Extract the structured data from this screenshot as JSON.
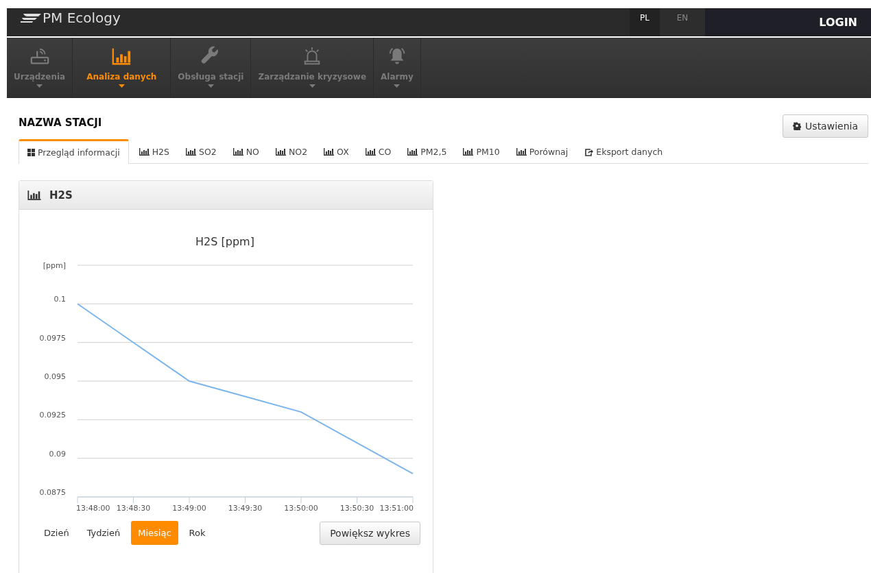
{
  "header": {
    "logo": "PM Ecology",
    "languages": [
      {
        "label": "PL",
        "selected": true
      },
      {
        "label": "EN",
        "selected": false
      }
    ],
    "login": "LOGIN"
  },
  "nav": [
    {
      "label": "Urządzenia",
      "kind": "router",
      "selected": false
    },
    {
      "label": "Analiza danych",
      "kind": "chart",
      "selected": true
    },
    {
      "label": "Obsługa stacji",
      "kind": "wrench",
      "selected": false
    },
    {
      "label": "Zarządzanie kryzysowe",
      "kind": "beacon",
      "selected": false
    },
    {
      "label": "Alarmy",
      "kind": "bell",
      "selected": false
    }
  ],
  "station": {
    "title": "NAZWA STACJI",
    "settings_button": "Ustawienia"
  },
  "tabs": [
    {
      "label": "Przegląd informacji",
      "kind": "grid",
      "selected": true
    },
    {
      "label": "H2S",
      "kind": "chart",
      "selected": false
    },
    {
      "label": "SO2",
      "kind": "chart",
      "selected": false
    },
    {
      "label": "NO",
      "kind": "chart",
      "selected": false
    },
    {
      "label": "NO2",
      "kind": "chart",
      "selected": false
    },
    {
      "label": "OX",
      "kind": "chart",
      "selected": false
    },
    {
      "label": "CO",
      "kind": "chart",
      "selected": false
    },
    {
      "label": "PM2,5",
      "kind": "chart",
      "selected": false
    },
    {
      "label": "PM10",
      "kind": "chart",
      "selected": false
    },
    {
      "label": "Porównaj",
      "kind": "chart",
      "selected": false
    },
    {
      "label": "Eksport danych",
      "kind": "export",
      "selected": false
    }
  ],
  "panel": {
    "title": "H2S",
    "chart_data": {
      "type": "line",
      "title": "H2S [ppm]",
      "ylabel": "[ppm]",
      "x": [
        "13:48:00",
        "13:48:30",
        "13:49:00",
        "13:49:30",
        "13:50:00",
        "13:50:30",
        "13:51:00"
      ],
      "series": [
        {
          "color": "#7cb5ec",
          "values": [
            0.1,
            0.0975,
            0.095,
            0.094,
            0.093,
            0.091,
            0.089
          ]
        }
      ],
      "ylim": [
        0.0875,
        0.1025
      ],
      "yticks": [
        0.0875,
        0.09,
        0.0925,
        0.095,
        0.0975,
        0.1
      ],
      "grid": true
    },
    "periods": [
      {
        "label": "Dzień",
        "selected": false
      },
      {
        "label": "Tydzień",
        "selected": false
      },
      {
        "label": "Miesiąc",
        "selected": true
      },
      {
        "label": "Rok",
        "selected": false
      }
    ],
    "zoom_button": "Powiększ wykres"
  }
}
